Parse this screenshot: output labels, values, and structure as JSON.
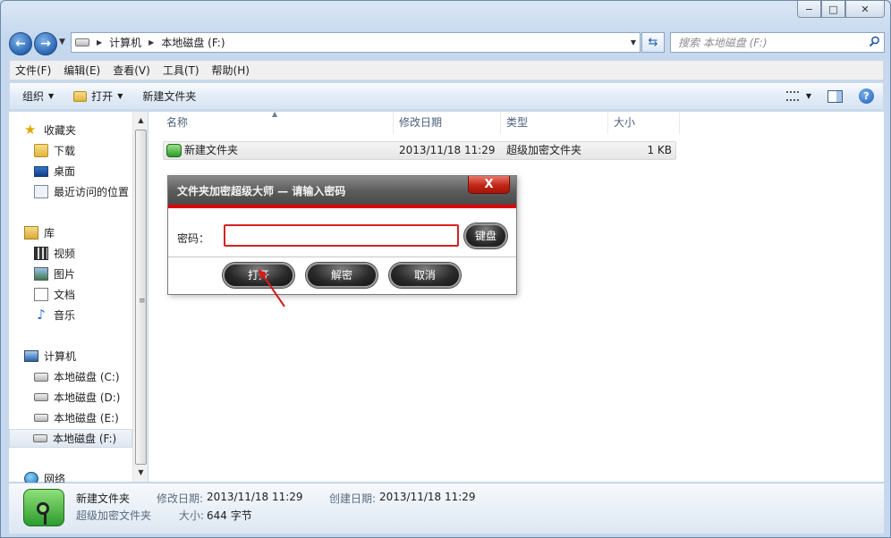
{
  "window": {
    "caption_buttons": {
      "minimize": "−",
      "maximize": "□",
      "close": "✕"
    }
  },
  "address_bar": {
    "breadcrumbs": [
      "计算机",
      "本地磁盘 (F:)"
    ],
    "search_placeholder": "搜索 本地磁盘 (F:)"
  },
  "menu": [
    "文件(F)",
    "编辑(E)",
    "查看(V)",
    "工具(T)",
    "帮助(H)"
  ],
  "commands": {
    "organize": "组织",
    "open": "打开",
    "new_folder": "新建文件夹"
  },
  "nav_pane": {
    "favorites": {
      "label": "收藏夹",
      "items": [
        "下载",
        "桌面",
        "最近访问的位置"
      ]
    },
    "libraries": {
      "label": "库",
      "items": [
        "视频",
        "图片",
        "文档",
        "音乐"
      ]
    },
    "computer": {
      "label": "计算机",
      "items": [
        "本地磁盘 (C:)",
        "本地磁盘 (D:)",
        "本地磁盘 (E:)",
        "本地磁盘 (F:)"
      ],
      "selected": "本地磁盘 (F:)"
    },
    "network": {
      "label": "网络"
    }
  },
  "columns": [
    "名称",
    "修改日期",
    "类型",
    "大小"
  ],
  "files": [
    {
      "name": "新建文件夹",
      "modified": "2013/11/18 11:29",
      "type": "超级加密文件夹",
      "size": "1 KB"
    }
  ],
  "details": {
    "name": "新建文件夹",
    "type": "超级加密文件夹",
    "modified_label": "修改日期:",
    "modified_value": "2013/11/18 11:29",
    "created_label": "创建日期:",
    "created_value": "2013/11/18 11:29",
    "size_label": "大小:",
    "size_value": "644 字节"
  },
  "dialog": {
    "title": "文件夹加密超级大师 — 请输入密码",
    "password_label": "密码：",
    "password_value": "",
    "keyboard_button": "键盘",
    "buttons": {
      "open": "打开",
      "decrypt": "解密",
      "cancel": "取消"
    },
    "close": "X"
  },
  "colors": {
    "accent_red": "#e00000",
    "title_gray": "#5a5a5a"
  }
}
